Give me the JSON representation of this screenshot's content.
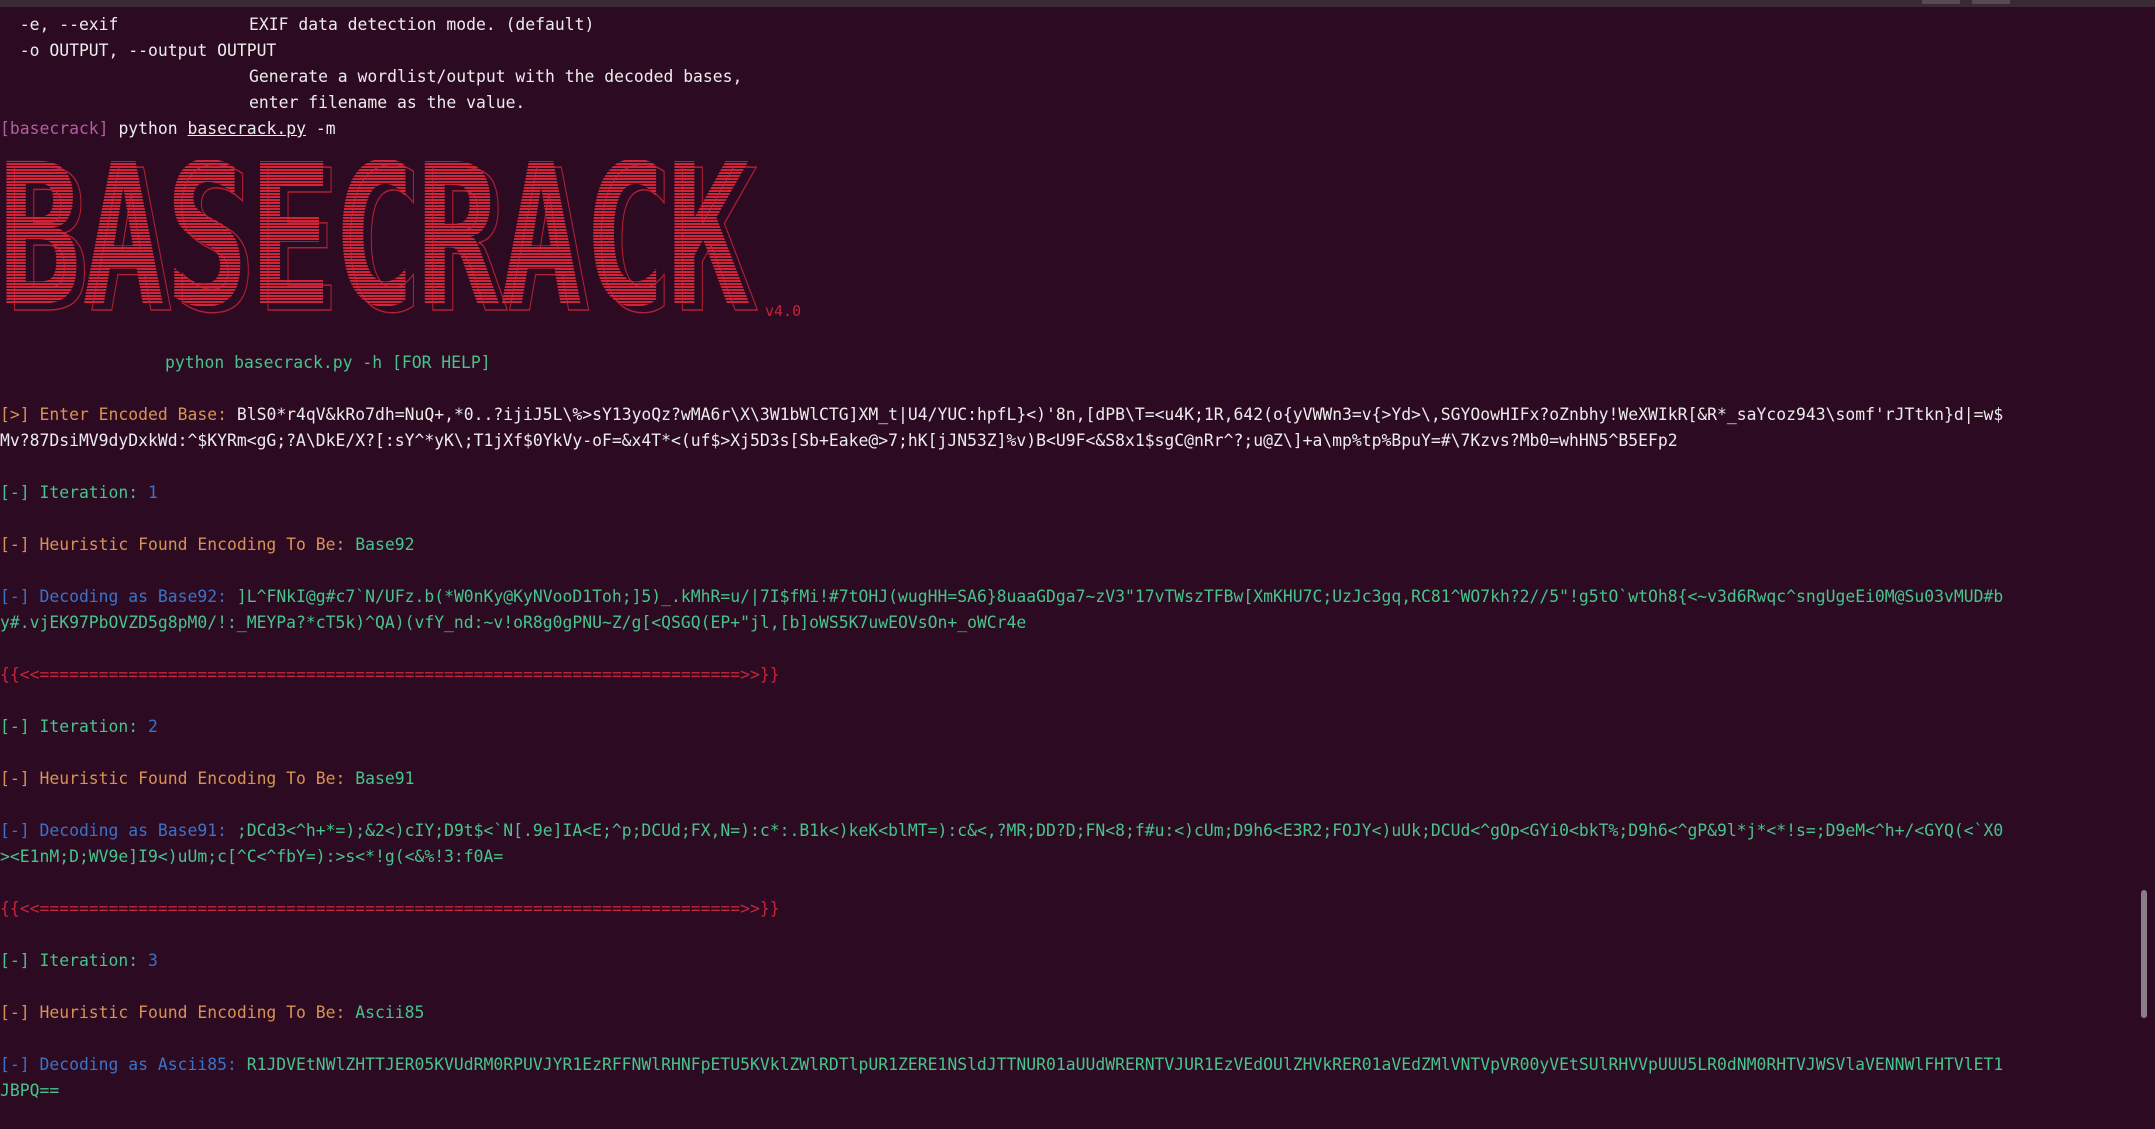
{
  "colors": {
    "background": "#2c0a22",
    "text": "#ececec",
    "red": "#c8243a",
    "purple": "#b25fa1",
    "orange": "#d89354",
    "green": "#46c48b",
    "blue": "#3b73c8"
  },
  "help": {
    "exif_flag": "  -e, --exif",
    "exif_desc": "EXIF data detection mode. (default)",
    "output_flag": "  -o OUTPUT, --output OUTPUT",
    "output_desc1": "Generate a wordlist/output with the decoded bases,",
    "output_desc2": "enter filename as the value."
  },
  "prompt": {
    "dir": "[basecrack]",
    "cmd": "python",
    "file": "basecrack.py",
    "args": "-m"
  },
  "banner": {
    "text": "BASECRACK",
    "version": "v4.0",
    "help_hint": "python basecrack.py -h [FOR HELP]"
  },
  "input": {
    "label": "[>] Enter Encoded Base: ",
    "line1": "BlS0*r4qV&kRo7dh=NuQ+,*0..?ijiJ5L\\%>sY13yoQz?wMA6r\\X\\3W1bWlCTG]XM_t|U4/YUC:hpfL}<)'8n,[dPB\\T=<u4K;1R,642(o{yVWWn3=v{>Yd>\\,SGYOowHIFx?oZnbhy!WeXWIkR[&R*_saYcoz943\\somf'rJTtkn}d|=w$",
    "line2": "Mv?87DsiMV9dyDxkWd:^$KYRm<gG;?A\\DkE/X?[:sY^*yK\\;T1jXf$0YkVy-oF=&x4T*<(uf$>Xj5D3s[Sb+Eake@>7;hK[jJN53Z]%v)B<U9F<&S8x1$sgC@nRr^?;u@Z\\]+a\\mp%tp%BpuY=#\\7Kzvs?Mb0=whHN5^B5EFp2"
  },
  "separator": "{{<<=======================================================================>>}}",
  "iterations": [
    {
      "iteration_label": "[-] Iteration: ",
      "number": "1",
      "heuristic_label": "[-] Heuristic Found Encoding To Be: ",
      "encoding": "Base92",
      "decoding_label": "[-] Decoding as Base92: ",
      "line1": "]L^FNkI@g#c7`N/UFz.b(*W0nKy@KyNVooD1Toh;]5)_.kMhR=u/|7I$fMi!#7tOHJ(wugHH=SA6}8uaaGDga7~zV3\"17vTWszTFBw[XmKHU7C;UzJc3gq,RC81^WO7kh?2//5\"!g5tO`wtOh8{<~v3d6Rwqc^sngUgeEi0M@Su03vMUD#b",
      "line2": "y#.vjEK97PbOVZD5g8pM0/!:_MEYPa?*cT5k)^QA)(vfY_nd:~v!oR8g0gPNU~Z/g[<QSGQ(EP+\"jl,[b]oWS5K7uwEOVsOn+_oWCr4e"
    },
    {
      "iteration_label": "[-] Iteration: ",
      "number": "2",
      "heuristic_label": "[-] Heuristic Found Encoding To Be: ",
      "encoding": "Base91",
      "decoding_label": "[-] Decoding as Base91: ",
      "line1": ";DCd3<^h+*=);&2<)cIY;D9t$<`N[.9e]IA<E;^p;DCUd;FX,N=):c*:.B1k<)keK<blMT=):c&<,?MR;DD?D;FN<8;f#u:<)cUm;D9h6<E3R2;FOJY<)uUk;DCUd<^gOp<GYi0<bkT%;D9h6<^gP&9l*j*<*!s=;D9eM<^h+/<GYQ(<`X0",
      "line2": "><E1nM;D;WV9e]I9<)uUm;c[^C<^fbY=):>s<*!g(<&%!3:f0A="
    },
    {
      "iteration_label": "[-] Iteration: ",
      "number": "3",
      "heuristic_label": "[-] Heuristic Found Encoding To Be: ",
      "encoding": "Ascii85",
      "decoding_label": "[-] Decoding as Ascii85: ",
      "line1": "R1JDVEtNWlZHTTJER05KVUdRM0RPUVJYR1EzRFFNWlRHNFpETU5KVklZWlRDTlpUR1ZERE1NSldJTTNUR01aUUdWRERNTVJUR1EzVEdOUlZHVkRER01aVEdZMlVNTVpVR00yVEtSUlRHVVpUUU5LR0dNM0RHTVJWSVlaVENNWlFHTVlET1",
      "line2": "JBPQ=="
    }
  ]
}
